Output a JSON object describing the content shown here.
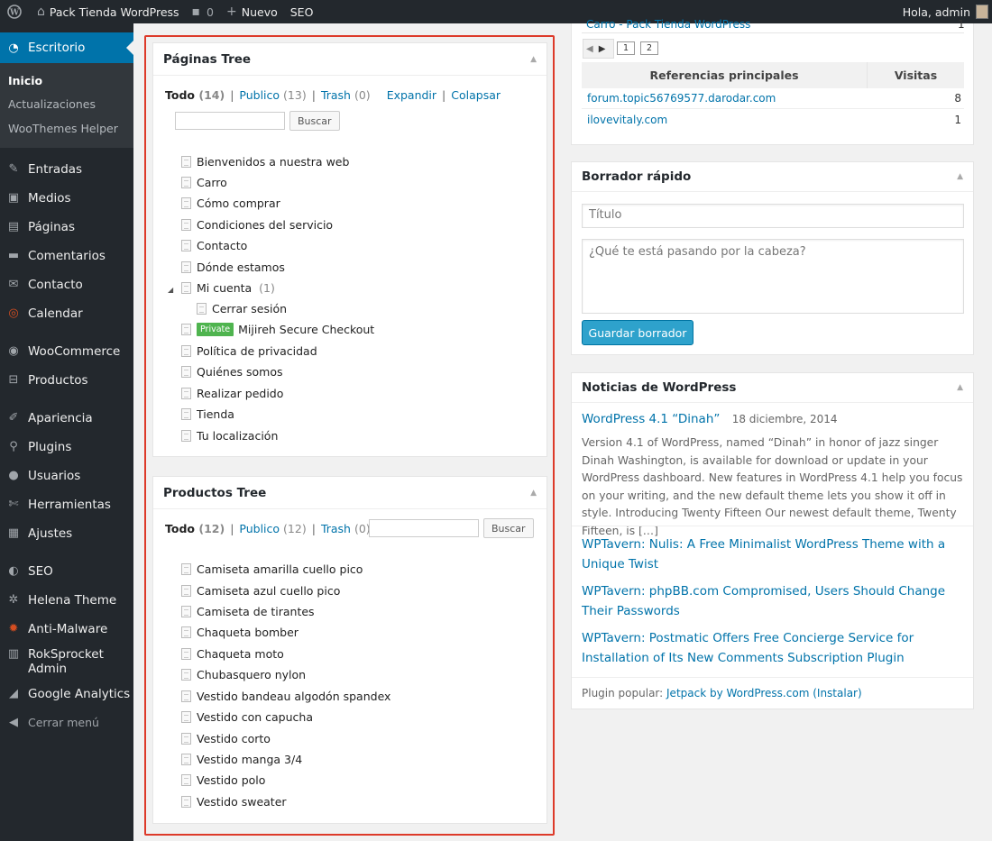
{
  "adminbar": {
    "site": "Pack Tienda WordPress",
    "comments": "0",
    "new": "Nuevo",
    "seo": "SEO",
    "greeting": "Hola, admin"
  },
  "sidebar": {
    "dashboard": "Escritorio",
    "sub": [
      "Inicio",
      "Actualizaciones",
      "WooThemes Helper"
    ],
    "items": [
      {
        "label": "Entradas",
        "icon": "pin-icon"
      },
      {
        "label": "Medios",
        "icon": "media-icon"
      },
      {
        "label": "Páginas",
        "icon": "pages-icon"
      },
      {
        "label": "Comentarios",
        "icon": "comment-icon"
      },
      {
        "label": "Contacto",
        "icon": "mail-icon"
      },
      {
        "label": "Calendar",
        "icon": "calendar-icon"
      },
      {
        "label": "WooCommerce",
        "icon": "woo-icon"
      },
      {
        "label": "Productos",
        "icon": "cart-icon"
      },
      {
        "label": "Apariencia",
        "icon": "brush-icon"
      },
      {
        "label": "Plugins",
        "icon": "plugin-icon"
      },
      {
        "label": "Usuarios",
        "icon": "user-icon"
      },
      {
        "label": "Herramientas",
        "icon": "wrench-icon"
      },
      {
        "label": "Ajustes",
        "icon": "settings-icon"
      },
      {
        "label": "SEO",
        "icon": "seo-icon"
      },
      {
        "label": "Helena Theme",
        "icon": "gear-icon"
      },
      {
        "label": "Anti-Malware",
        "icon": "shield-icon"
      },
      {
        "label": "RokSprocket Admin",
        "icon": "box-icon"
      },
      {
        "label": "Google Analytics",
        "icon": "chart-icon"
      }
    ],
    "collapse": "Cerrar menú"
  },
  "pages_tree": {
    "title": "Páginas Tree",
    "todo": "Todo",
    "todo_count": "(14)",
    "publico": "Publico",
    "publico_count": "(13)",
    "trash": "Trash",
    "trash_count": "(0)",
    "expand": "Expandir",
    "collapse": "Colapsar",
    "search_btn": "Buscar",
    "items": [
      "Bienvenidos a nuestra web",
      "Carro",
      "Cómo comprar",
      "Condiciones del servicio",
      "Contacto",
      "Dónde estamos",
      "Mi cuenta",
      "Cerrar sesión",
      "Mijireh Secure Checkout",
      "Política de privacidad",
      "Quiénes somos",
      "Realizar pedido",
      "Tienda",
      "Tu localización"
    ],
    "mi_cuenta_count": "(1)",
    "private_badge": "Private"
  },
  "products_tree": {
    "title": "Productos Tree",
    "todo": "Todo",
    "todo_count": "(12)",
    "publico": "Publico",
    "publico_count": "(12)",
    "trash": "Trash",
    "trash_count": "(0)",
    "search_btn": "Buscar",
    "items": [
      "Camiseta amarilla cuello pico",
      "Camiseta azul cuello pico",
      "Camiseta de tirantes",
      "Chaqueta bomber",
      "Chaqueta moto",
      "Chubasquero nylon",
      "Vestido bandeau algodón spandex",
      "Vestido con capucha",
      "Vestido corto",
      "Vestido manga 3/4",
      "Vestido polo",
      "Vestido sweater"
    ]
  },
  "stats": {
    "top_row": "Carro - Pack Tienda WordPress",
    "top_count": "1",
    "pages": [
      "1",
      "2"
    ],
    "col_ref": "Referencias principales",
    "col_visits": "Visitas",
    "rows": [
      {
        "ref": "forum.topic56769577.darodar.com",
        "visits": "8"
      },
      {
        "ref": "ilovevitaly.com",
        "visits": "1"
      }
    ]
  },
  "quick_draft": {
    "title": "Borrador rápido",
    "title_placeholder": "Título",
    "content_placeholder": "¿Qué te está pasando por la cabeza?",
    "save": "Guardar borrador"
  },
  "news": {
    "title": "Noticias de WordPress",
    "main_link": "WordPress 4.1 “Dinah”",
    "date": "18 diciembre, 2014",
    "excerpt": "Version 4.1 of WordPress, named “Dinah” in honor of jazz singer Dinah Washington, is available for download or update in your WordPress dashboard. New features in WordPress 4.1 help you focus on your writing, and the new default theme lets you show it off in style. Introducing Twenty Fifteen Our newest default theme, Twenty Fifteen, is […]",
    "links": [
      "WPTavern: Nulis: A Free Minimalist WordPress Theme with a Unique Twist",
      "WPTavern: phpBB.com Compromised, Users Should Change Their Passwords",
      "WPTavern: Postmatic Offers Free Concierge Service for Installation of Its New Comments Subscription Plugin"
    ],
    "popular_label": "Plugin popular:",
    "popular_link": "Jetpack by WordPress.com",
    "install": "(Instalar)"
  }
}
